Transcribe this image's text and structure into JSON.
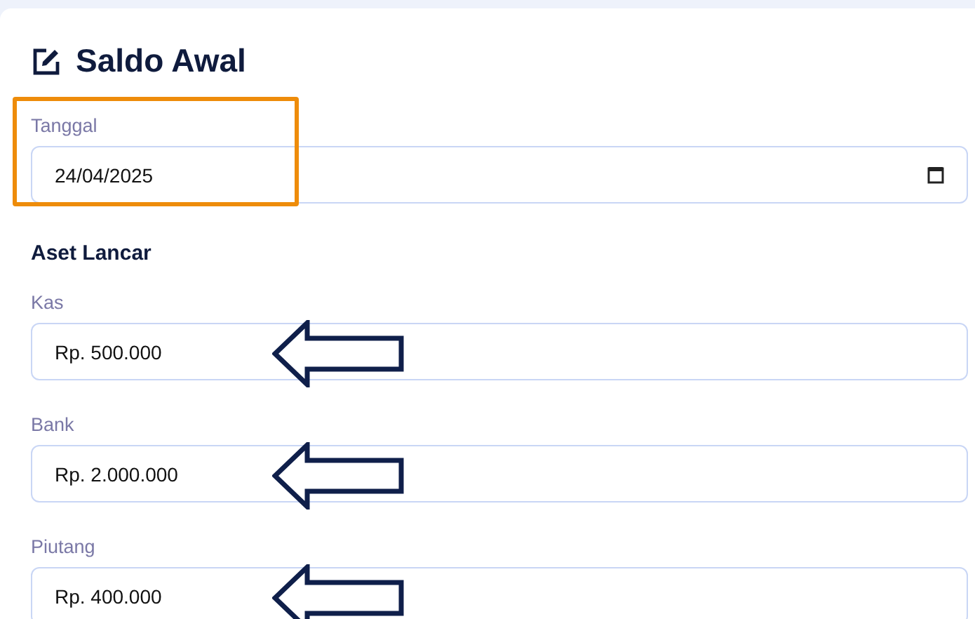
{
  "title": "Saldo Awal",
  "date_field": {
    "label": "Tanggal",
    "value": "24/04/2025",
    "highlighted": true
  },
  "section": {
    "title": "Aset Lancar"
  },
  "fields": [
    {
      "label": "Kas",
      "value": "Rp. 500.000",
      "arrow": true
    },
    {
      "label": "Bank",
      "value": "Rp. 2.000.000",
      "arrow": true
    },
    {
      "label": "Piutang",
      "value": "Rp. 400.000",
      "arrow": true
    }
  ]
}
